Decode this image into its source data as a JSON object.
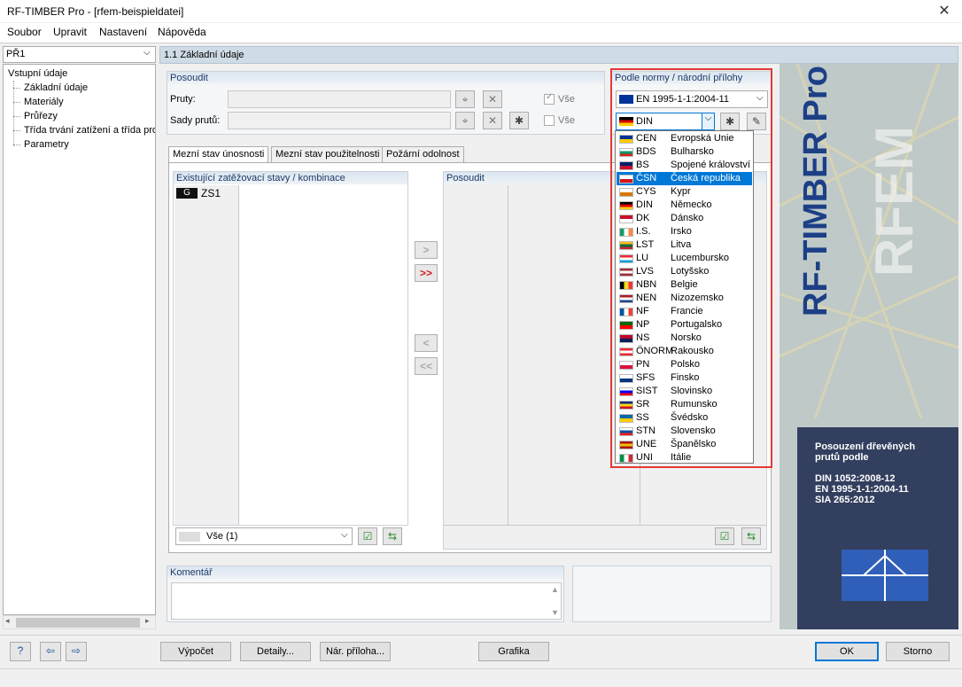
{
  "window": {
    "title": "RF-TIMBER Pro - [rfem-beispieldatei]",
    "close": "✕"
  },
  "menu": [
    "Soubor",
    "Upravit",
    "Nastavení",
    "Nápověda"
  ],
  "nav": {
    "combo": "PŘ1",
    "arrow": "⌵",
    "tree_root": "Vstupní údaje",
    "tree_items": [
      "Základní údaje",
      "Materiály",
      "Průřezy",
      "Třída trvání zatížení a třída pro",
      "Parametry"
    ]
  },
  "section": {
    "title": "1.1 Základní údaje"
  },
  "posoudit": {
    "header": "Posoudit",
    "members_label": "Pruty:",
    "sets_label": "Sady prutů:",
    "all1": "Vše",
    "all2": "Vše"
  },
  "norm": {
    "header": "Podle normy / národní přílohy",
    "standard": "EN 1995-1-1:2004-11",
    "annex": "DIN"
  },
  "tabs": [
    "Mezní stav únosnosti",
    "Mezní stav použitelnosti",
    "Požární odolnost"
  ],
  "load_cases": {
    "header": "Existující zatěžovací stavy / kombinace",
    "badge": "G",
    "item": "ZS1",
    "filter": "Vše (1)"
  },
  "design_list": {
    "header": "Posoudit"
  },
  "move": {
    "right": ">",
    "all_right": ">>",
    "left": "<",
    "all_left": "<<"
  },
  "comment": {
    "header": "Komentář"
  },
  "buttons": {
    "calc": "Výpočet",
    "details": "Detaily...",
    "annex": "Nár. příloha...",
    "graphics": "Grafika",
    "ok": "OK",
    "cancel": "Storno"
  },
  "logo": {
    "brand": "RF-TIMBER Pro",
    "watermark": "RFEM",
    "desc": [
      "Posouzení dřevěných",
      "prutů podle"
    ],
    "norms": [
      "DIN 1052:2008-12",
      "EN 1995-1-1:2004-11",
      "SIA 265:2012"
    ]
  },
  "dropdown": [
    {
      "code": "CEN",
      "name": "Evropská Unie",
      "colors": [
        "#003399",
        "#ffcc00"
      ]
    },
    {
      "code": "BDS",
      "name": "Bulharsko",
      "colors": [
        "#ffffff",
        "#00966e",
        "#d62612"
      ]
    },
    {
      "code": "BS",
      "name": "Spojené království",
      "colors": [
        "#012169",
        "#c8102e"
      ]
    },
    {
      "code": "ČSN",
      "name": "Česká republika",
      "colors": [
        "#ffffff",
        "#d7141a"
      ]
    },
    {
      "code": "CYS",
      "name": "Kypr",
      "colors": [
        "#ffffff",
        "#d57800"
      ]
    },
    {
      "code": "DIN",
      "name": "Německo",
      "colors": [
        "#000000",
        "#dd0000",
        "#ffce00"
      ]
    },
    {
      "code": "DK",
      "name": "Dánsko",
      "colors": [
        "#c8102e",
        "#ffffff"
      ]
    },
    {
      "code": "I.S.",
      "name": "Irsko",
      "colors": [
        "#169b62",
        "#ffffff",
        "#ff883e"
      ]
    },
    {
      "code": "LST",
      "name": "Litva",
      "colors": [
        "#fdb913",
        "#006a44",
        "#c1272d"
      ]
    },
    {
      "code": "LU",
      "name": "Lucembursko",
      "colors": [
        "#ed2939",
        "#ffffff",
        "#00a1de"
      ]
    },
    {
      "code": "LVS",
      "name": "Lotyšsko",
      "colors": [
        "#9e3039",
        "#ffffff",
        "#9e3039"
      ]
    },
    {
      "code": "NBN",
      "name": "Belgie",
      "colors": [
        "#000000",
        "#fdda24",
        "#ef3340"
      ]
    },
    {
      "code": "NEN",
      "name": "Nizozemsko",
      "colors": [
        "#ae1c28",
        "#ffffff",
        "#21468b"
      ]
    },
    {
      "code": "NF",
      "name": "Francie",
      "colors": [
        "#0055a4",
        "#ffffff",
        "#ef4135"
      ]
    },
    {
      "code": "NP",
      "name": "Portugalsko",
      "colors": [
        "#006600",
        "#ff0000"
      ]
    },
    {
      "code": "NS",
      "name": "Norsko",
      "colors": [
        "#ba0c2f",
        "#00205b"
      ]
    },
    {
      "code": "ÖNORM",
      "name": "Rakousko",
      "colors": [
        "#ed2939",
        "#ffffff",
        "#ed2939"
      ]
    },
    {
      "code": "PN",
      "name": "Polsko",
      "colors": [
        "#ffffff",
        "#dc143c"
      ]
    },
    {
      "code": "SFS",
      "name": "Finsko",
      "colors": [
        "#ffffff",
        "#003580"
      ]
    },
    {
      "code": "SIST",
      "name": "Slovinsko",
      "colors": [
        "#ffffff",
        "#0000ff",
        "#ff0000"
      ]
    },
    {
      "code": "SR",
      "name": "Rumunsko",
      "colors": [
        "#002b7f",
        "#fcd116",
        "#ce1126"
      ]
    },
    {
      "code": "SS",
      "name": "Švédsko",
      "colors": [
        "#006aa7",
        "#fecc00"
      ]
    },
    {
      "code": "STN",
      "name": "Slovensko",
      "colors": [
        "#ffffff",
        "#0b4ea2",
        "#ee1c25"
      ]
    },
    {
      "code": "UNE",
      "name": "Španělsko",
      "colors": [
        "#aa151b",
        "#f1bf00",
        "#aa151b"
      ]
    },
    {
      "code": "UNI",
      "name": "Itálie",
      "colors": [
        "#009246",
        "#ffffff",
        "#ce2b37"
      ]
    }
  ],
  "selected_index": 3
}
